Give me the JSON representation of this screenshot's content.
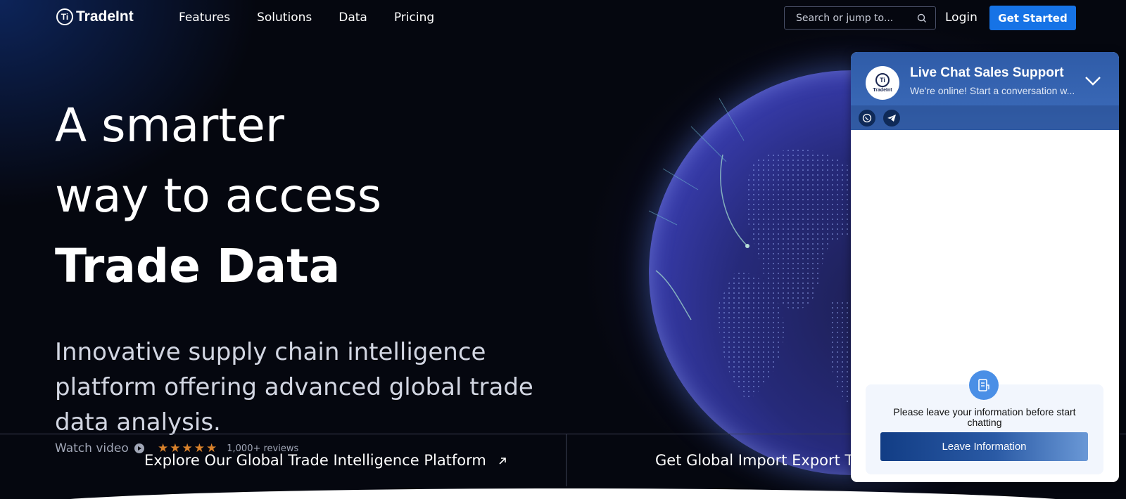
{
  "header": {
    "logo_text": "TradeInt",
    "nav": [
      "Features",
      "Solutions",
      "Data",
      "Pricing"
    ],
    "search_placeholder": "Search or jump to...",
    "login": "Login",
    "get_started": "Get Started"
  },
  "hero": {
    "line1": "A smarter",
    "line2": "way to access",
    "line3": "Trade Data",
    "subtitle": "Innovative supply chain intelligence platform offering advanced global trade data analysis.",
    "watch_video": "Watch video",
    "rating_stars": 5,
    "reviews": "1,000+ reviews"
  },
  "bottom": {
    "explore": "Explore Our Global Trade Intelligence Platform",
    "import": "Get Global Import Export Tra"
  },
  "chat": {
    "title": "Live Chat Sales Support",
    "subtitle": "We're online! Start a conversation w...",
    "avatar_text": "TradeInt",
    "form_text": "Please leave your information before start chatting",
    "form_button": "Leave Information"
  },
  "colors": {
    "primary": "#1673e6",
    "background": "#05070f",
    "star": "#d9822b",
    "chat_header": "#3d6cbb"
  }
}
